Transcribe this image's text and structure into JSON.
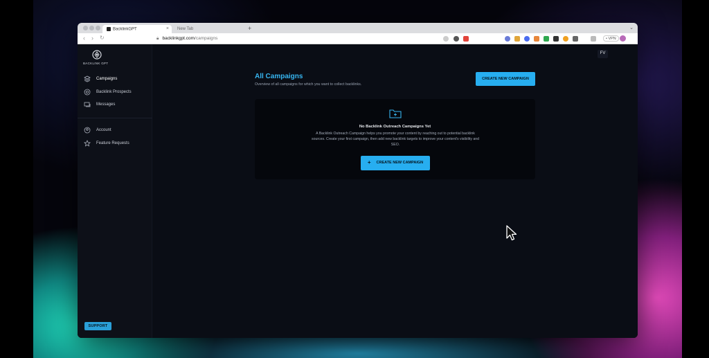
{
  "browser": {
    "tabs": [
      {
        "title": "BacklinkGPT",
        "active": true
      },
      {
        "title": "New Tab",
        "active": false
      }
    ],
    "new_tab_symbol": "+",
    "tab_close_symbol": "×",
    "url_host": "backlinkgpt.com",
    "url_path": "/campaigns",
    "vpn_label": "• VPN"
  },
  "sidebar": {
    "logo_text": "BACKLINK GPT",
    "items": [
      {
        "label": "Campaigns",
        "icon": "layers-icon",
        "active": true
      },
      {
        "label": "Backlink Prospects",
        "icon": "target-icon",
        "active": false
      },
      {
        "label": "Messages",
        "icon": "messages-icon",
        "active": false
      }
    ],
    "secondary_items": [
      {
        "label": "Account",
        "icon": "account-icon"
      },
      {
        "label": "Feature Requests",
        "icon": "star-icon"
      }
    ],
    "support_label": "SUPPORT"
  },
  "header": {
    "user_initials": "FV"
  },
  "main": {
    "title": "All Campaigns",
    "subtitle": "Overview of all campaigns for which you want to collect backlinks.",
    "create_button_label": "CREATE NEW CAMPAIGN",
    "empty_state": {
      "icon": "folder-plus-icon",
      "title": "No Backlink Outreach Campaigns Yet",
      "description": "A Backlink Outreach Campaign helps you promote your content by reaching out to potential backlink sources. Create your first campaign, then add new backlink targets to improve your content's visibility and SEO.",
      "button_label": "CREATE NEW CAMPAIGN",
      "button_icon": "plus-icon"
    }
  },
  "colors": {
    "accent": "#27aef0",
    "background": "#0a0d15",
    "sidebar": "#0d1018"
  }
}
